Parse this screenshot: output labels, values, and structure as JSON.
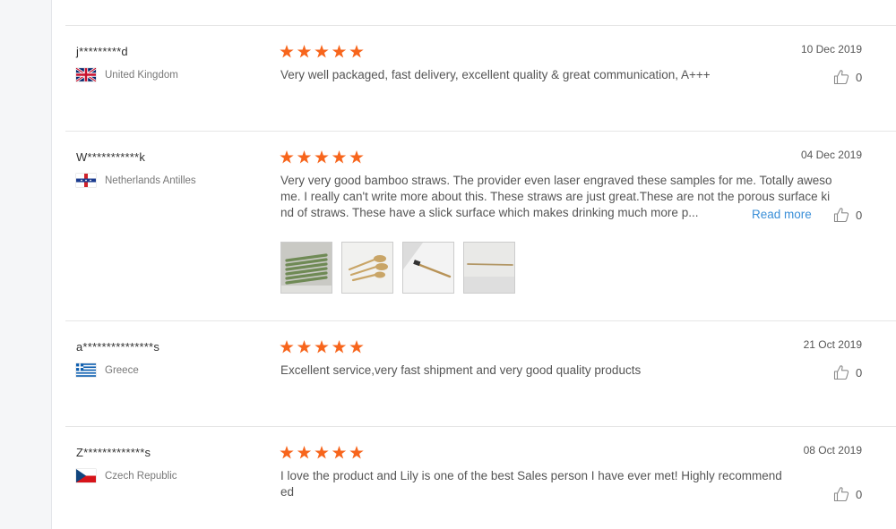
{
  "reviews": [
    {
      "user": "j*********d",
      "country": "United Kingdom",
      "flag_icon": "uk-flag-icon",
      "rating": 5,
      "date": "10 Dec 2019",
      "comment": "Very well packaged, fast delivery, excellent quality & great communication, A+++",
      "likes": "0"
    },
    {
      "user": "W***********k",
      "country": "Netherlands Antilles",
      "flag_icon": "netherlands-antilles-flag-icon",
      "rating": 5,
      "date": "04 Dec 2019",
      "comment": "Very very good bamboo straws. The provider even laser engraved these samples for me. Totally awesome. I really can't write more about this. These straws are just great.These are not the porous surface kind of straws. These have a slick surface which makes drinking much more p...",
      "read_more": "Read more",
      "likes": "0",
      "photos": [
        "bamboo-straws-photo",
        "wooden-spoons-photo",
        "bamboo-toothbrush-photo",
        "single-straw-photo"
      ]
    },
    {
      "user": "a***************s",
      "country": "Greece",
      "flag_icon": "greece-flag-icon",
      "rating": 5,
      "date": "21 Oct 2019",
      "comment": "Excellent service,very fast shipment and very good quality products",
      "likes": "0"
    },
    {
      "user": "Z*************s",
      "country": "Czech Republic",
      "flag_icon": "czech-flag-icon",
      "rating": 5,
      "date": "08 Oct 2019",
      "comment": "I love the product and Lily is one of the best Sales person I have ever met! Highly recommended",
      "likes": "0"
    }
  ],
  "colors": {
    "star": "#f7651c",
    "link": "#3a8fd8"
  }
}
